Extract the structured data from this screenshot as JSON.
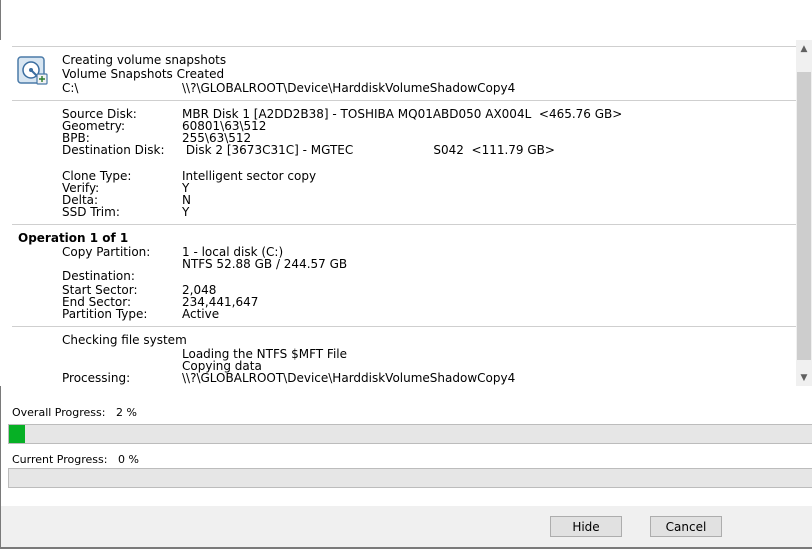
{
  "log": {
    "snapshot": {
      "title": "Creating volume snapshots",
      "status": "Volume Snapshots Created",
      "drive": "C:\\",
      "path": "\\\\?\\GLOBALROOT\\Device\\HarddiskVolumeShadowCopy4"
    },
    "disk_info": {
      "source_label": "Source Disk:",
      "source_value": "MBR Disk 1 [A2DD2B38] - TOSHIBA MQ01ABD050 AX004L  <465.76 GB>",
      "geometry_label": "Geometry:",
      "geometry_value": "60801\\63\\512",
      "bpb_label": "BPB:",
      "bpb_value": "255\\63\\512",
      "dest_label": "Destination Disk:",
      "dest_value": " Disk 2 [3673C31C] - MGTEC                     S042  <111.79 GB>"
    },
    "clone": {
      "type_label": "Clone Type:",
      "type_value": "Intelligent sector copy",
      "verify_label": "Verify:",
      "verify_value": "Y",
      "delta_label": "Delta:",
      "delta_value": "N",
      "ssd_label": "SSD Trim:",
      "ssd_value": "Y"
    },
    "operation": {
      "heading": "Operation 1 of 1",
      "copy_label": "Copy Partition:",
      "copy_value": "1 - local disk (C:)",
      "fs_value": "NTFS 52.88 GB / 244.57 GB",
      "dest_label": "Destination:",
      "start_label": "Start Sector:",
      "start_value": "2,048",
      "end_label": "End Sector:",
      "end_value": "234,441,647",
      "ptype_label": "Partition Type:",
      "ptype_value": "Active"
    },
    "checking": {
      "title": "Checking file system",
      "line1": "Loading the NTFS $MFT File",
      "line2": "Copying data",
      "processing_label": "Processing:",
      "processing_value": "\\\\?\\GLOBALROOT\\Device\\HarddiskVolumeShadowCopy4"
    }
  },
  "progress": {
    "overall_label": "Overall Progress:   2 %",
    "overall_value": 0.02,
    "current_label": "Current Progress:   0 %",
    "current_value": 0.0
  },
  "buttons": {
    "hide": "Hide",
    "cancel": "Cancel"
  },
  "icons": {
    "disk": "disk-clone-icon",
    "scroll_up": "chevron-up-icon",
    "scroll_down": "chevron-down-icon"
  },
  "colors": {
    "progress_fill": "#06b025",
    "progress_track": "#e6e6e6"
  }
}
